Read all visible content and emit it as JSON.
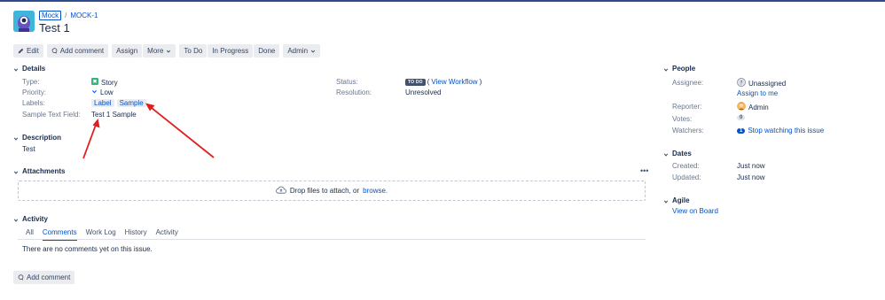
{
  "header": {
    "project_link": "Mock",
    "separator": "/",
    "issue_key": "MOCK-1",
    "issue_title": "Test 1"
  },
  "toolbar": {
    "edit": "Edit",
    "add_comment": "Add comment",
    "assign": "Assign",
    "more": "More",
    "todo": "To Do",
    "in_progress": "In Progress",
    "done": "Done",
    "admin": "Admin"
  },
  "details": {
    "heading": "Details",
    "type_label": "Type:",
    "type_value": "Story",
    "priority_label": "Priority:",
    "priority_value": "Low",
    "labels_label": "Labels:",
    "labels": [
      "Label",
      "Sample"
    ],
    "sample_field_label": "Sample Text Field:",
    "sample_field_value": "Test 1 Sample",
    "status_label": "Status:",
    "status_value": "TO DO",
    "view_workflow": "View Workflow",
    "resolution_label": "Resolution:",
    "resolution_value": "Unresolved"
  },
  "description": {
    "heading": "Description",
    "text": "Test"
  },
  "attachments": {
    "heading": "Attachments",
    "more": "•••",
    "drop_text": "Drop files to attach, or",
    "browse": "browse."
  },
  "activity": {
    "heading": "Activity",
    "tabs": [
      "All",
      "Comments",
      "Work Log",
      "History",
      "Activity"
    ],
    "active_tab": "Comments",
    "empty_text": "There are no comments yet on this issue.",
    "add_comment": "Add comment"
  },
  "people": {
    "heading": "People",
    "assignee_label": "Assignee:",
    "assignee_value": "Unassigned",
    "assign_to_me": "Assign to me",
    "reporter_label": "Reporter:",
    "reporter_value": "Admin",
    "votes_label": "Votes:",
    "votes_value": "0",
    "watchers_label": "Watchers:",
    "watchers_count": "1",
    "stop_watching": "Stop watching this issue"
  },
  "dates": {
    "heading": "Dates",
    "created_label": "Created:",
    "created_value": "Just now",
    "updated_label": "Updated:",
    "updated_value": "Just now"
  },
  "agile": {
    "heading": "Agile",
    "view_on_board": "View on Board"
  },
  "colors": {
    "accent": "#0052cc",
    "annotation": "#e0201f",
    "story_icon": "#36b37e",
    "top_bar": "#2e4b8c"
  },
  "icons": {
    "project_avatar": "project-avatar-icon",
    "edit": "pencil-icon",
    "comment": "comment-icon",
    "twixie": "chevron-down-icon",
    "story": "story-icon",
    "priority_low": "priority-low-icon",
    "upload": "cloud-upload-icon",
    "unassigned": "unassigned-avatar-icon",
    "admin": "admin-avatar-icon"
  }
}
